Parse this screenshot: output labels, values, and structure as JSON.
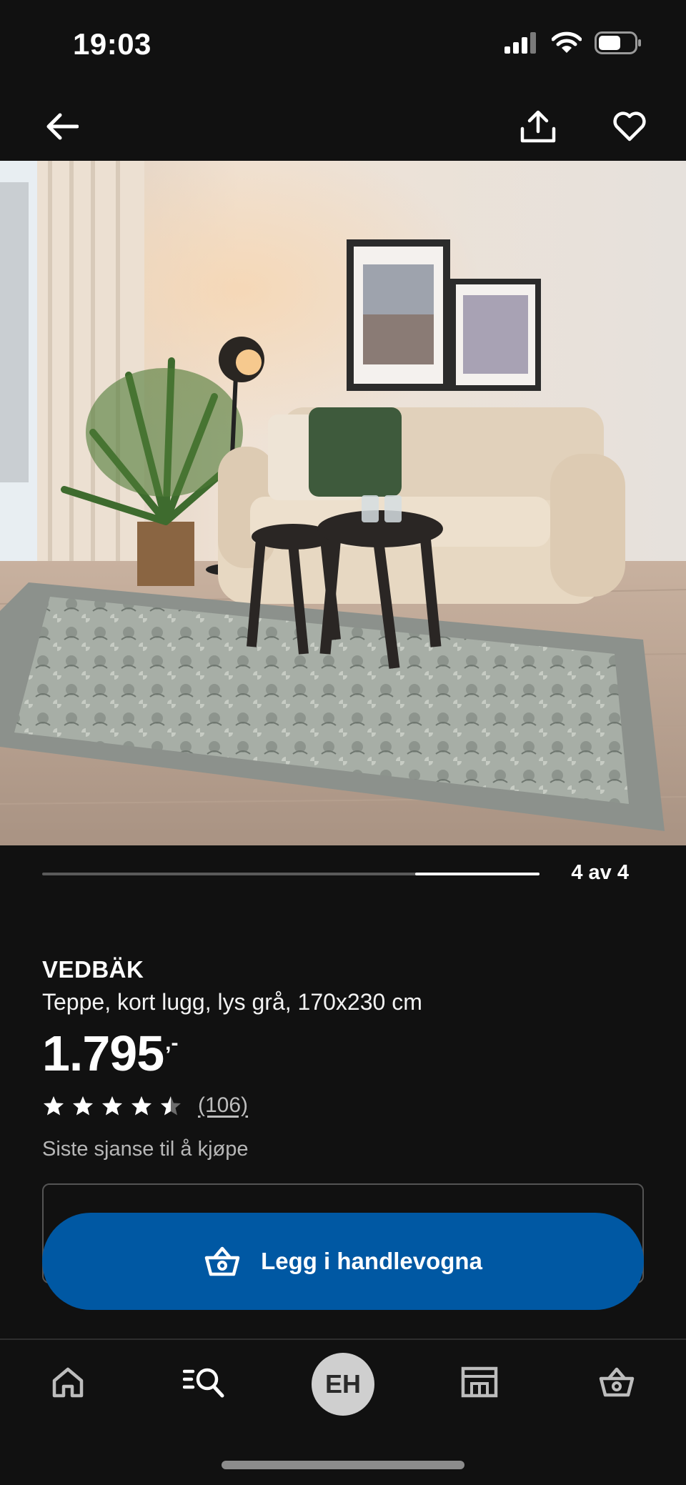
{
  "status_bar": {
    "time": "19:03",
    "icons": [
      "signal-icon",
      "wifi-icon",
      "battery-icon"
    ]
  },
  "top_nav": {
    "icons": [
      "back-arrow-icon",
      "share-icon",
      "heart-icon"
    ]
  },
  "carousel": {
    "counter": "4 av 4",
    "current": 4,
    "total": 4
  },
  "product": {
    "name": "VEDBÄK",
    "description": "Teppe, kort lugg, lys grå, 170x230 cm",
    "price": "1.795",
    "price_suffix": ",-",
    "rating": 4.5,
    "rating_max": 5,
    "review_count": "(106)",
    "availability": "Siste sjanse til å kjøpe"
  },
  "cta": {
    "label": "Legg i handlevogna",
    "icon": "basket-icon"
  },
  "bottom_nav": {
    "tabs": [
      "home-icon",
      "search-icon",
      "profile-avatar",
      "store-icon",
      "cart-icon"
    ],
    "avatar_initials": "EH"
  },
  "colors": {
    "background": "#111111",
    "accent": "#0058a3",
    "avatar": "#cfcfcf"
  }
}
